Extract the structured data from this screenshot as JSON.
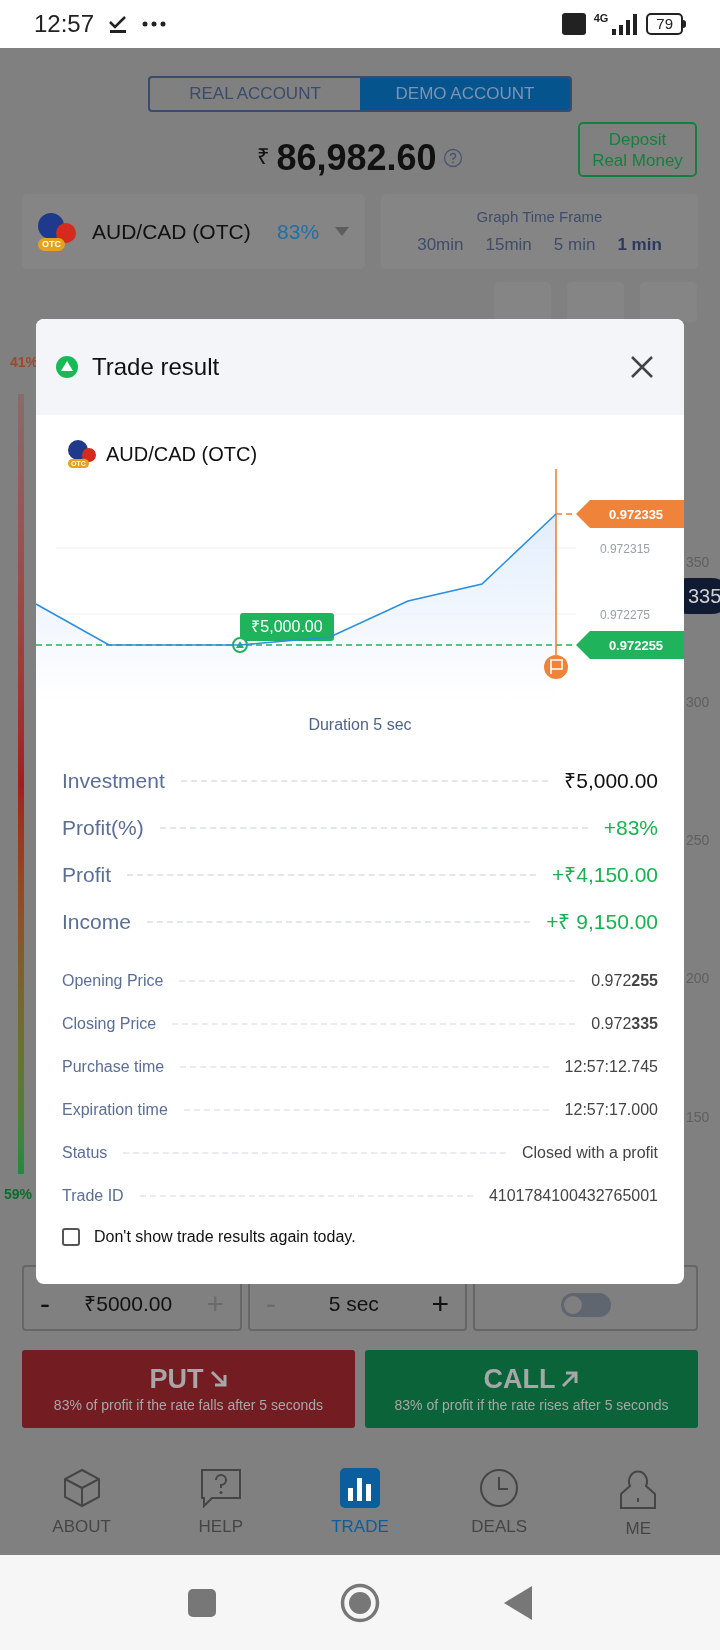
{
  "status_bar": {
    "time": "12:57",
    "network": "4G",
    "battery": "79"
  },
  "account_tabs": [
    {
      "label": "REAL ACCOUNT",
      "selected": false
    },
    {
      "label": "DEMO ACCOUNT",
      "selected": true
    }
  ],
  "balance": {
    "currency": "₹",
    "amount": "86,982.60"
  },
  "deposit_button": "Deposit\nReal Money",
  "asset": {
    "name": "AUD/CAD (OTC)",
    "badge": "OTC",
    "payout": "83%"
  },
  "time_frame": {
    "title": "Graph Time Frame",
    "options": [
      {
        "label": "30min",
        "selected": false
      },
      {
        "label": "15min",
        "selected": false
      },
      {
        "label": "5 min",
        "selected": false
      },
      {
        "label": "1 min",
        "selected": true
      }
    ]
  },
  "background_chart": {
    "left_labels": [
      "41%",
      "59%"
    ],
    "right_labels": [
      "350",
      "300",
      "250",
      "200",
      "150"
    ],
    "current_price": "335"
  },
  "modal": {
    "title": "Trade result",
    "asset": "AUD/CAD (OTC)",
    "asset_badge": "OTC",
    "chart": {
      "stake_label": "₹5,000.00",
      "open_marker": "0.972255",
      "close_marker": "0.972335",
      "grid_labels": [
        "0.972315",
        "0.972275"
      ]
    },
    "duration": "Duration 5 sec",
    "main_rows": [
      {
        "label": "Investment",
        "value": "₹5,000.00",
        "positive": false
      },
      {
        "label": "Profit(%)",
        "value": "+83%",
        "positive": true
      },
      {
        "label": "Profit",
        "value": "+₹4,150.00",
        "positive": true
      },
      {
        "label": "Income",
        "value": "+₹ 9,150.00",
        "positive": true
      }
    ],
    "detail_rows": [
      {
        "label": "Opening Price",
        "value": "0.972**255**"
      },
      {
        "label": "Closing Price",
        "value": "0.972**335**"
      },
      {
        "label": "Purchase time",
        "value": "12:57:12.745"
      },
      {
        "label": "Expiration time",
        "value": "12:57:17.000"
      },
      {
        "label": "Status",
        "value": "Closed with a profit"
      },
      {
        "label": "Trade ID",
        "value": "4101784100432765001"
      }
    ],
    "dont_show": {
      "label": "Don't show trade results again today.",
      "checked": false
    }
  },
  "amount_field": {
    "minus": "-",
    "value": "₹5000.00",
    "plus": "+"
  },
  "time_field": {
    "minus": "-",
    "value": "5 sec",
    "plus": "+"
  },
  "one_click": {
    "on": false
  },
  "put_button": {
    "title": "PUT",
    "subtitle": "83% of profit if the rate falls after 5 seconds"
  },
  "call_button": {
    "title": "CALL",
    "subtitle": "83% of profit if the rate rises after 5 seconds"
  },
  "bottom_nav": [
    {
      "kind": "box",
      "label": "ABOUT",
      "selected": false
    },
    {
      "kind": "help",
      "label": "HELP",
      "selected": false
    },
    {
      "kind": "chart",
      "label": "TRADE",
      "selected": true
    },
    {
      "kind": "clock",
      "label": "DEALS",
      "selected": false
    },
    {
      "kind": "user",
      "label": "ME",
      "selected": false
    }
  ]
}
